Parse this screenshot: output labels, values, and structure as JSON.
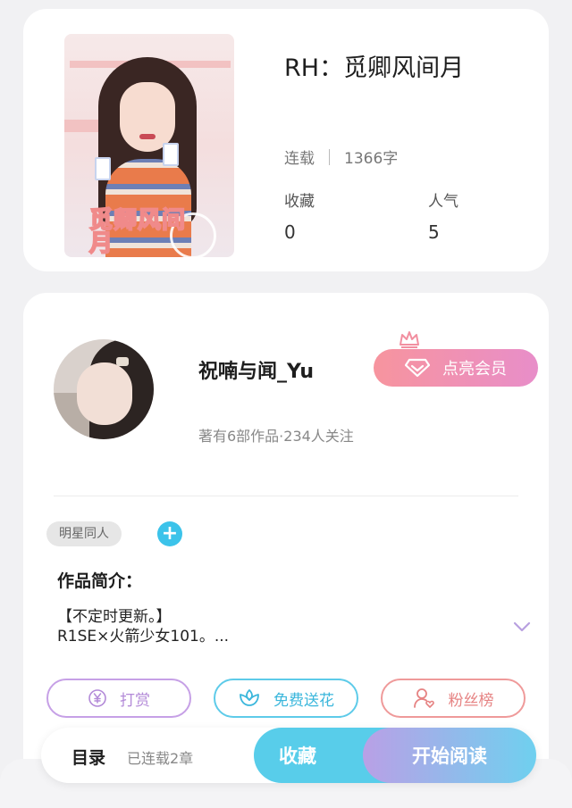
{
  "book": {
    "title": "RH：觅卿风间月",
    "status": "连载",
    "word_count": "1366字",
    "favorites_label": "收藏",
    "favorites_value": "0",
    "popularity_label": "人气",
    "popularity_value": "5",
    "cover_text": "觅卿风间月"
  },
  "author": {
    "name": "祝喃与闻_Yu",
    "summary": "著有6部作品·234人关注",
    "vip_label": "点亮会员"
  },
  "tags": {
    "items": [
      "明星同人"
    ],
    "add_symbol": "+"
  },
  "intro": {
    "label": "作品简介：",
    "line1": "【不定时更新。】",
    "line2": "R1SE×火箭少女101。..."
  },
  "actions": {
    "reward": "打赏",
    "flower": "免费送花",
    "fans": "粉丝榜"
  },
  "bottom_bar": {
    "toc_label": "目录",
    "chapters": "已连载2章",
    "favorite": "收藏",
    "read": "开始阅读"
  },
  "colors": {
    "accent_blue": "#58cdea",
    "vip_pink": "#f7949e",
    "reward_purple": "#b38ad8",
    "fans_red": "#e68383"
  }
}
